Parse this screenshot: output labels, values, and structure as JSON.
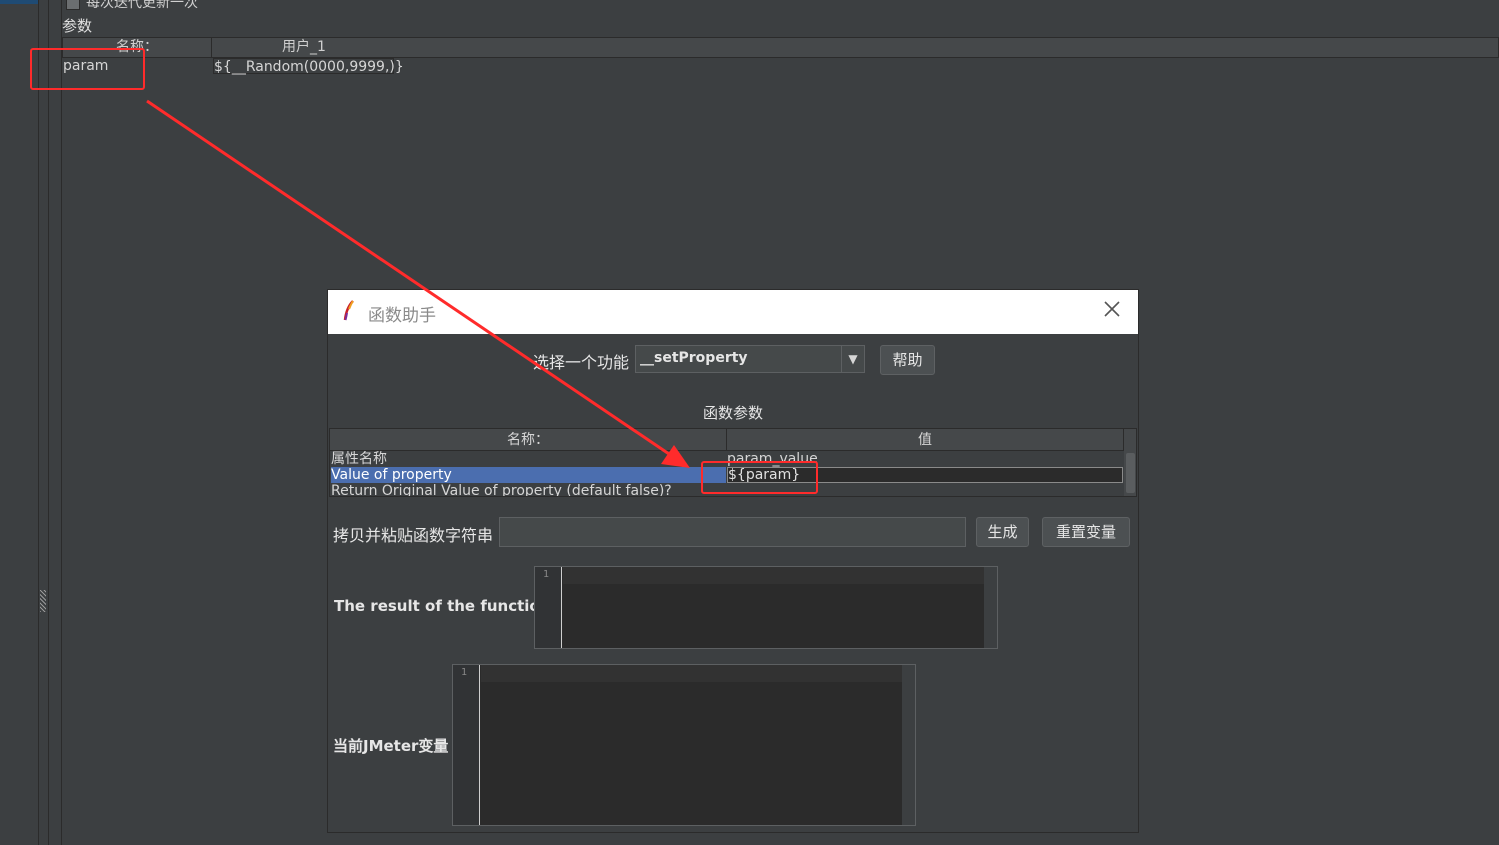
{
  "background": {
    "iteration_checkbox_label": "每次迭代更新一次",
    "params_label": "参数",
    "table": {
      "col_name_header": "名称：",
      "col_user_header": "用户_1",
      "rows": [
        {
          "name": "param",
          "value": "${__Random(0000,9999,)}"
        }
      ]
    }
  },
  "dialog": {
    "title": "函数助手",
    "close_icon": "close-icon",
    "function_select_label": "选择一个功能",
    "function_selected": "__setProperty",
    "help_button": "帮助",
    "params_title": "函数参数",
    "params_table": {
      "col_name_header": "名称：",
      "col_value_header": "值",
      "rows": [
        {
          "name": "属性名称",
          "value": "param_value"
        },
        {
          "name": "Value of property",
          "value": "${param}"
        },
        {
          "name": "Return Original Value of property (default false)?",
          "value": ""
        }
      ]
    },
    "copy_paste_label": "拷贝并粘贴函数字符串",
    "copy_paste_value": "",
    "generate_button": "生成",
    "reset_button": "重置变量",
    "result_label": "The result of the function is",
    "result_editor_line": "1",
    "vars_label": "当前JMeter变量",
    "vars_editor_line": "1"
  },
  "colors": {
    "annotation_red": "#ff2b2b",
    "selection_blue": "#4b6eaf",
    "panel_bg": "#3c3f41"
  }
}
